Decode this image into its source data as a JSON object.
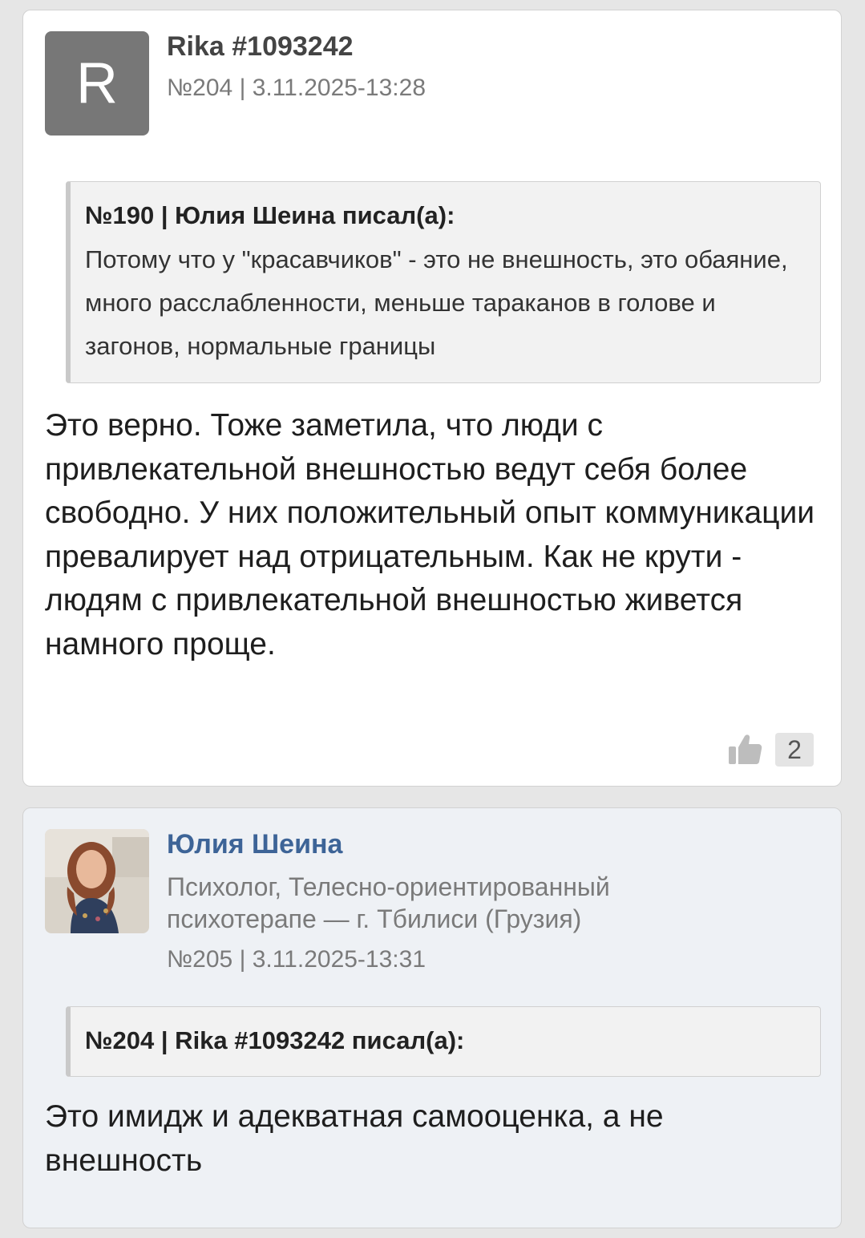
{
  "posts": [
    {
      "avatar_letter": "R",
      "author": "Rika #1093242",
      "meta": "№204 | 3.11.2025-13:28",
      "quote": {
        "header": "№190 | Юлия Шеина писал(а):",
        "text": "Потому что у \"красавчиков\" - это не внешность, это обаяние, много расслабленности, меньше тараканов в голове и загонов, нормальные границы"
      },
      "text": "Это верно. Тоже заметила, что люди с привлекательной внешностью ведут себя более свободно. У них положительный опыт коммуникации превалирует над отрицательным. Как не крути - людям с привлекательной внешностью живется намного проще.",
      "likes": "2",
      "like_icon": "thumbs-up-icon"
    },
    {
      "author": "Юлия Шеина",
      "profession": "Психолог, Телесно-ориентированный психотерапе — г. Тбилиси (Грузия)",
      "meta": "№205 | 3.11.2025-13:31",
      "quote": {
        "header": "№204 | Rika #1093242 писал(а):"
      },
      "text": "Это имидж и адекватная самооценка, а не внешность"
    }
  ],
  "colors": {
    "page_bg": "#e6e6e6",
    "author_link": "#3d6497",
    "avatar_gray": "#777777",
    "expert_post_bg": "#eef1f5"
  }
}
